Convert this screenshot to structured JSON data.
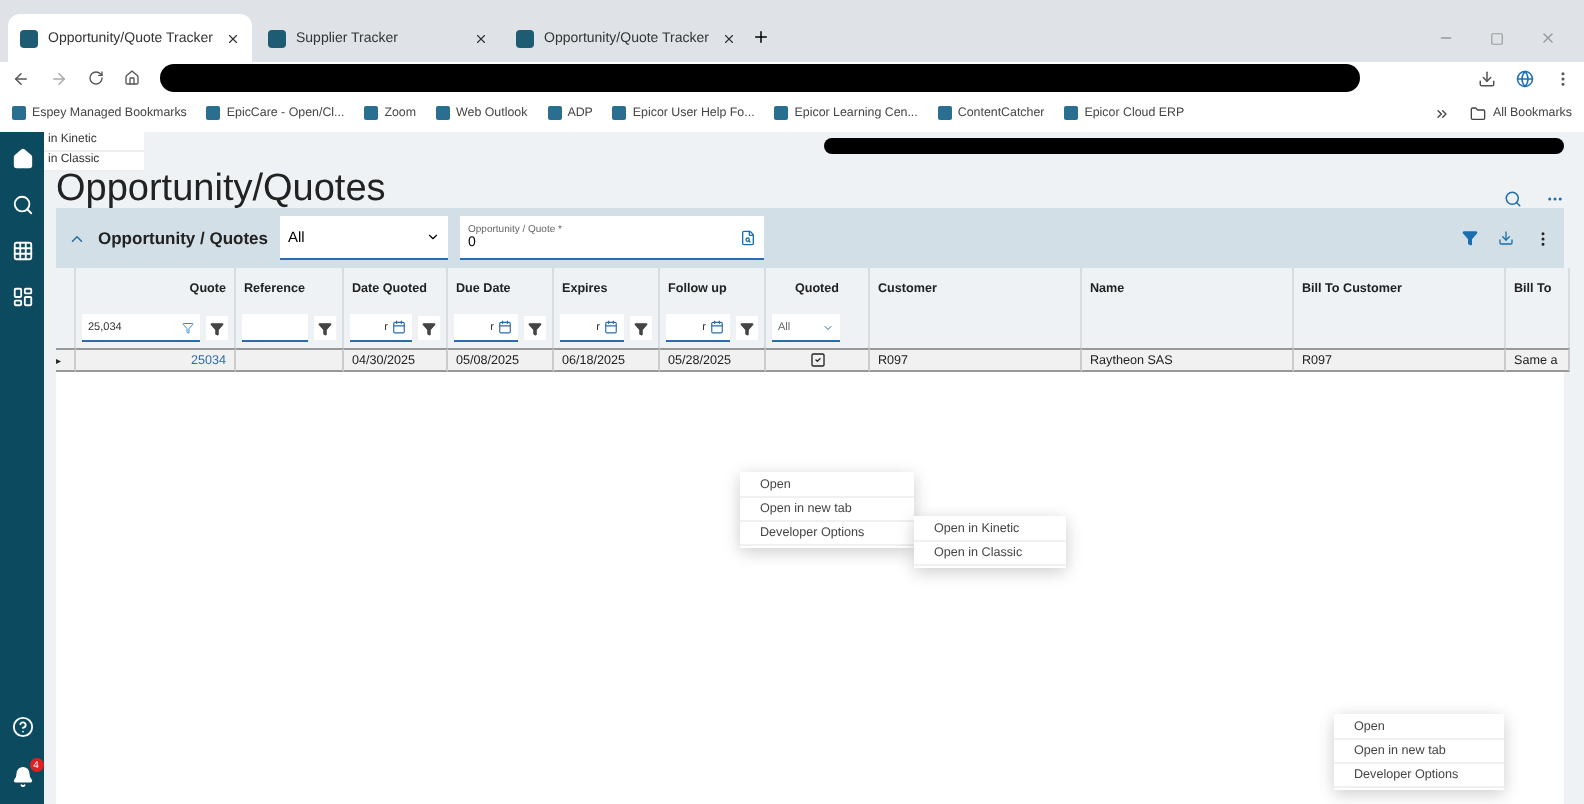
{
  "browser": {
    "tabs": [
      {
        "title": "Opportunity/Quote Tracker",
        "selected": true
      },
      {
        "title": "Supplier Tracker",
        "selected": false
      },
      {
        "title": "Opportunity/Quote Tracker",
        "selected": false
      }
    ],
    "bookmarks": [
      "Espey Managed Bookmarks",
      "EpicCare - Open/Cl...",
      "Zoom",
      "Web Outlook",
      "ADP",
      "Epicor User Help Fo...",
      "Epicor Learning Cen...",
      "ContentCatcher",
      "Epicor Cloud ERP"
    ],
    "all_bookmarks": "All Bookmarks"
  },
  "sidebar": {
    "notification_count": "4"
  },
  "corner_menu": [
    "in Kinetic",
    "in Classic"
  ],
  "page_title": "Opportunity/Quotes",
  "panel": {
    "title": "Opportunity / Quotes",
    "filter_select": "All",
    "search_field": {
      "label": "Opportunity / Quote *",
      "value": "0"
    }
  },
  "grid": {
    "columns": [
      {
        "label": "Quote"
      },
      {
        "label": "Reference"
      },
      {
        "label": "Date Quoted"
      },
      {
        "label": "Due Date"
      },
      {
        "label": "Expires"
      },
      {
        "label": "Follow up"
      },
      {
        "label": "Quoted"
      },
      {
        "label": "Customer"
      },
      {
        "label": "Name"
      },
      {
        "label": "Bill To Customer"
      },
      {
        "label": "Bill To"
      }
    ],
    "filters": [
      {
        "kind": "text",
        "value": "25,034",
        "active": true
      },
      {
        "kind": "text",
        "active": false
      },
      {
        "kind": "date",
        "value": "r"
      },
      {
        "kind": "date",
        "value": "r"
      },
      {
        "kind": "date",
        "value": "r"
      },
      {
        "kind": "date",
        "value": "r"
      },
      {
        "kind": "select",
        "value": "All"
      },
      {
        "kind": "none"
      },
      {
        "kind": "none"
      },
      {
        "kind": "none"
      },
      {
        "kind": "none"
      }
    ],
    "rows": [
      {
        "pointer": "▸",
        "quote": "25034",
        "date_quoted": "04/30/2025",
        "due_date": "05/08/2025",
        "expires": "06/18/2025",
        "follow_up": "05/28/2025",
        "quoted": true,
        "customer": "R097",
        "name": "Raytheon SAS",
        "bill_to_customer": "R097",
        "bill_to": "Same a"
      }
    ]
  },
  "context_menus": [
    {
      "items": [
        "Open",
        "Open in new tab",
        "Developer Options"
      ],
      "submenu": [
        "Open in Kinetic",
        "Open in Classic"
      ]
    },
    {
      "items": [
        "Open",
        "Open in new tab",
        "Developer Options"
      ]
    }
  ]
}
